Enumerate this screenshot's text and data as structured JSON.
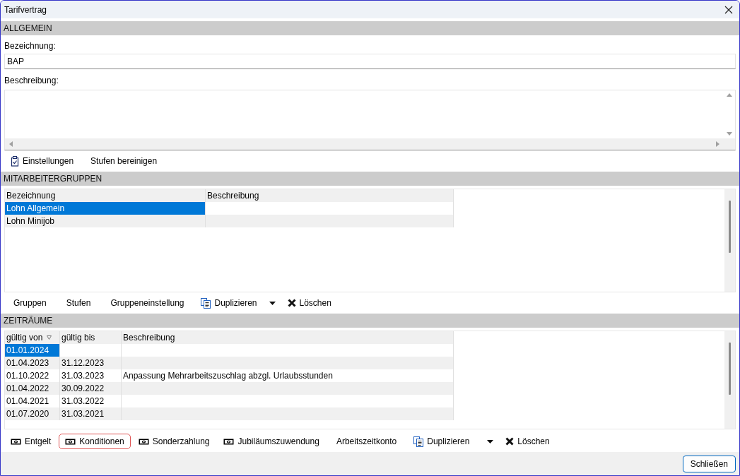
{
  "window": {
    "title": "Tarifvertrag"
  },
  "allgemein": {
    "header": "ALLGEMEIN",
    "name_label": "Bezeichnung:",
    "name_value": "BAP",
    "description_label": "Beschreibung:"
  },
  "allgemein_toolbar": [
    {
      "label": "Einstellungen",
      "kind": "settings"
    },
    {
      "label": "Stufen bereinigen",
      "kind": "plain"
    }
  ],
  "mitarbeitergruppen": {
    "header": "MITARBEITERGRUPPEN",
    "columns": [
      {
        "label": "Bezeichnung",
        "sorted": false
      },
      {
        "label": "Beschreibung",
        "sorted": false
      }
    ],
    "rows": [
      {
        "cells": [
          "Lohn Allgemein",
          null
        ],
        "selected": true
      },
      {
        "cells": [
          "Lohn Minijob",
          null
        ],
        "selected": false
      }
    ]
  },
  "gruppen_toolbar": [
    {
      "label": "Gruppen",
      "kind": "plain"
    },
    {
      "label": "Stufen",
      "kind": "plain"
    },
    {
      "label": "Gruppeneinstellung",
      "kind": "plain"
    },
    {
      "label": "Duplizieren",
      "kind": "duplicate",
      "dropdown": true
    },
    {
      "label": "Löschen",
      "kind": "delete"
    }
  ],
  "zeitraeume": {
    "header": "ZEITRÄUME",
    "columns": [
      {
        "label": "gültig von",
        "sorted": true
      },
      {
        "label": "gültig bis",
        "sorted": false
      },
      {
        "label": "Beschreibung",
        "sorted": false
      }
    ],
    "rows": [
      {
        "cells": [
          "01.01.2024",
          null,
          null
        ],
        "selected": true
      },
      {
        "cells": [
          "01.04.2023",
          "31.12.2023",
          null
        ],
        "selected": false
      },
      {
        "cells": [
          "01.10.2022",
          "31.03.2023",
          "Anpassung Mehrarbeitszuschlag abzgl. Urlaubsstunden"
        ],
        "selected": false
      },
      {
        "cells": [
          "01.04.2022",
          "30.09.2022",
          null
        ],
        "selected": false
      },
      {
        "cells": [
          "01.04.2021",
          "31.03.2022",
          null
        ],
        "selected": false
      },
      {
        "cells": [
          "01.07.2020",
          "31.03.2021",
          null
        ],
        "selected": false
      }
    ]
  },
  "zeitraeume_toolbar": [
    {
      "label": "Entgelt",
      "kind": "payment",
      "highlighted": false
    },
    {
      "label": "Konditionen",
      "kind": "payment",
      "highlighted": true
    },
    {
      "label": "Sonderzahlung",
      "kind": "payment",
      "highlighted": false
    },
    {
      "label": "Jubiläumszuwendung",
      "kind": "payment",
      "highlighted": false
    },
    {
      "label": "Arbeitszeitkonto",
      "kind": "plain",
      "highlighted": false
    },
    {
      "label": "Duplizieren",
      "kind": "duplicate",
      "dropdown": true,
      "highlighted": false
    },
    {
      "label": "Löschen",
      "kind": "delete",
      "highlighted": false
    }
  ],
  "footer": {
    "close_button": "Schließen"
  }
}
